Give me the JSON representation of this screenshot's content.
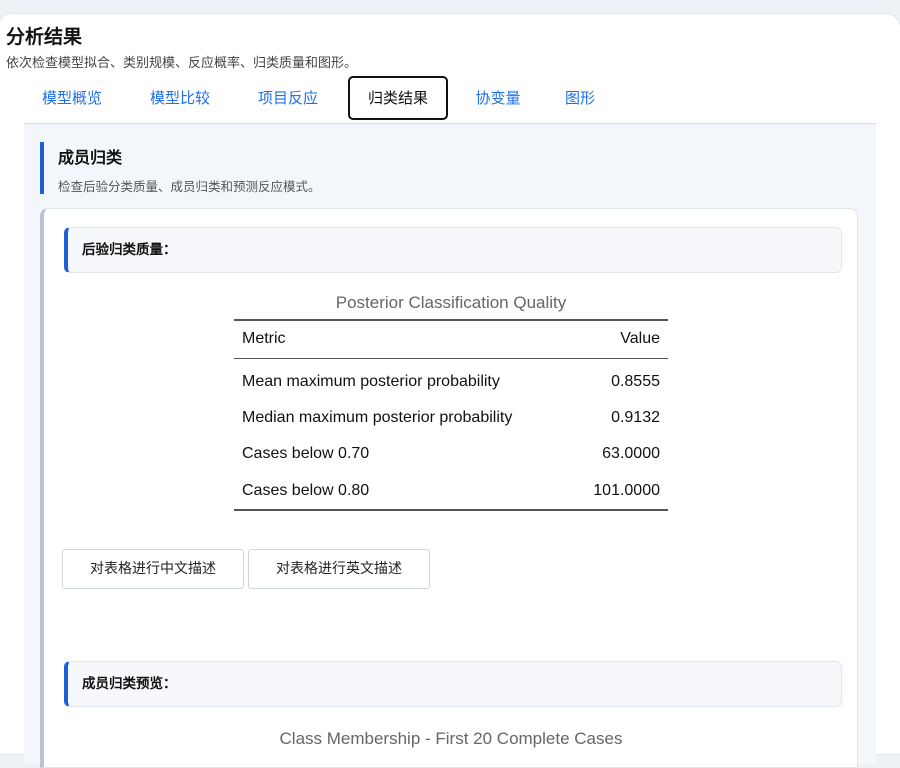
{
  "header": {
    "title": "分析结果",
    "subtitle": "依次检查模型拟合、类别规模、反应概率、归类质量和图形。"
  },
  "tabs": [
    {
      "label": "模型概览"
    },
    {
      "label": "模型比较"
    },
    {
      "label": "项目反应"
    },
    {
      "label": "归类结果",
      "active": true
    },
    {
      "label": "协变量"
    },
    {
      "label": "图形"
    }
  ],
  "section": {
    "title": "成员归类",
    "subtitle": "检查后验分类质量、成员归类和预测反应模式。"
  },
  "quality": {
    "heading": "后验归类质量：",
    "table": {
      "caption": "Posterior Classification Quality",
      "headers": [
        "Metric",
        "Value"
      ],
      "rows": [
        {
          "metric": "Mean maximum posterior probability",
          "value": "0.8555"
        },
        {
          "metric": "Median maximum posterior probability",
          "value": "0.9132"
        },
        {
          "metric": "Cases below 0.70",
          "value": "63.0000"
        },
        {
          "metric": "Cases below 0.80",
          "value": "101.0000"
        }
      ]
    },
    "buttons": {
      "describe_zh": "对表格进行中文描述",
      "describe_en": "对表格进行英文描述"
    }
  },
  "preview": {
    "heading": "成员归类预览：",
    "table_caption": "Class Membership - First 20 Complete Cases"
  },
  "colors": {
    "accent": "#1f5fd6",
    "link": "#1f6feb"
  }
}
